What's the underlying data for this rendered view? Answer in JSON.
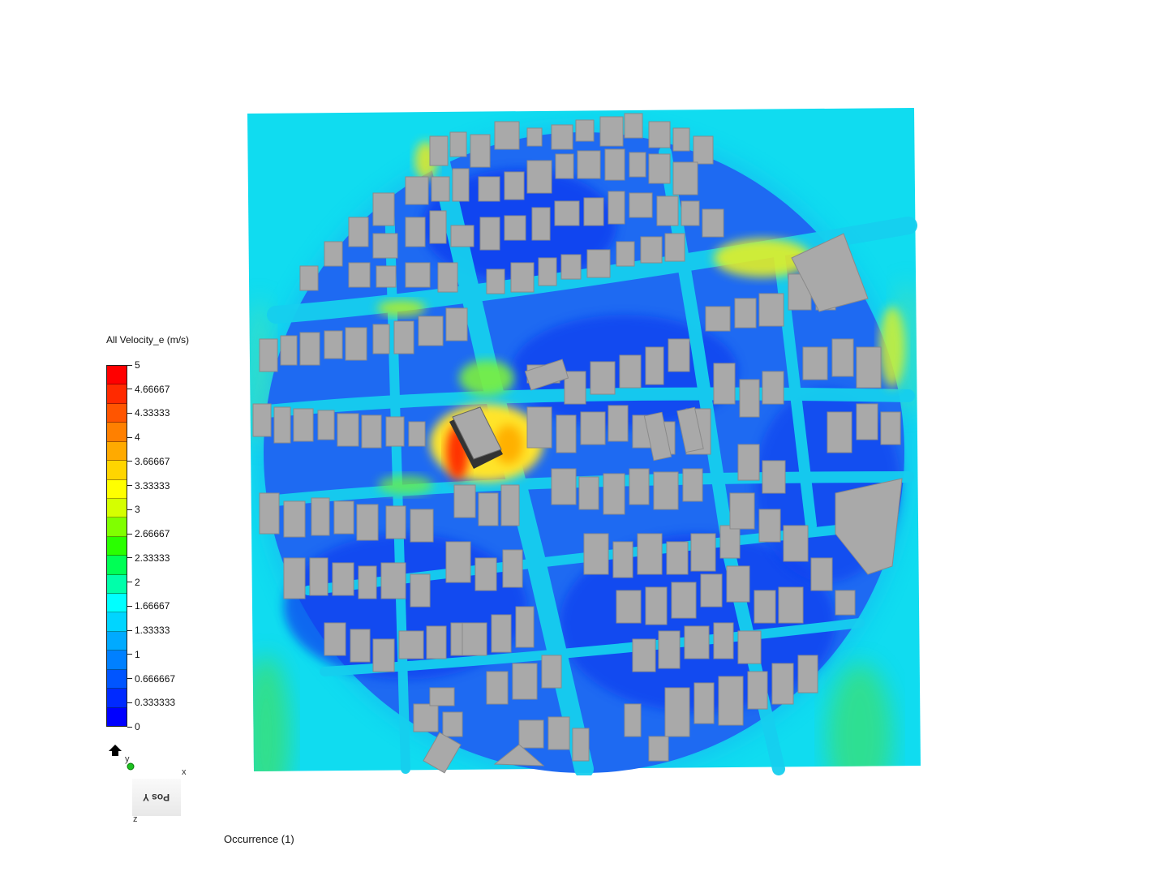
{
  "legend": {
    "title": "All Velocity_e (m/s)",
    "ticks": [
      "5",
      "4.66667",
      "4.33333",
      "4",
      "3.66667",
      "3.33333",
      "3",
      "2.66667",
      "2.33333",
      "2",
      "1.66667",
      "1.33333",
      "1",
      "0.666667",
      "0.333333",
      "0"
    ],
    "colors": [
      "#ff0000",
      "#ff2a00",
      "#ff5500",
      "#ff8000",
      "#ffaa00",
      "#ffd500",
      "#ffff00",
      "#d5ff00",
      "#80ff00",
      "#2aff00",
      "#00ff55",
      "#00ffaa",
      "#00ffff",
      "#00d5ff",
      "#00aaff",
      "#0080ff",
      "#0055ff",
      "#002aff",
      "#0000ff"
    ],
    "min": 0,
    "max": 5
  },
  "axis_widget": {
    "x_label": "x",
    "y_label": "y",
    "z_label": "z",
    "view_label": "Pos Y"
  },
  "status": {
    "occurrence": "Occurrence (1)"
  },
  "colors": {
    "domain_background": "#10dcf0",
    "building": "#a9a9a9",
    "low_velocity": "#0a48f0",
    "high_velocity": "#ff3000"
  }
}
